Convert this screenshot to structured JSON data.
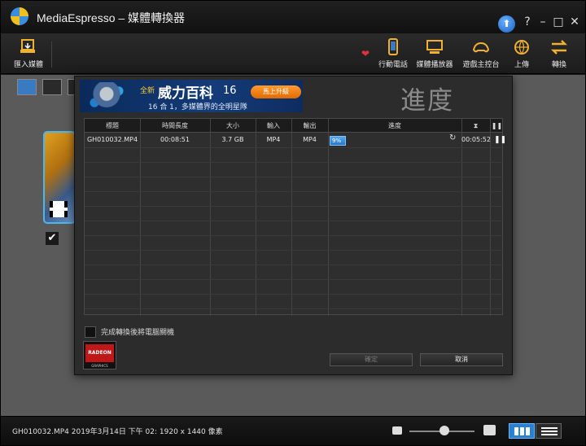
{
  "app": {
    "title": "MediaEspresso – 媒體轉換器"
  },
  "window_controls": {
    "help": "?",
    "minimize": "–",
    "maximize": "□",
    "close": "✕"
  },
  "toolbar": {
    "import_label": "匯入媒體",
    "items": [
      {
        "label": "行動電話",
        "icon": "phone-icon"
      },
      {
        "label": "媒體播放器",
        "icon": "media-player-icon"
      },
      {
        "label": "遊戲主控台",
        "icon": "game-console-icon"
      },
      {
        "label": "上傳",
        "icon": "upload-globe-icon"
      },
      {
        "label": "轉換",
        "icon": "convert-icon"
      }
    ]
  },
  "banner": {
    "new_label": "全新",
    "title": "威力百科",
    "number": "16",
    "subtitle": "16 合 1，多媒體界的全明星隊",
    "button": "馬上升級"
  },
  "dialog": {
    "title": "進度",
    "columns": [
      "標題",
      "時間長度",
      "大小",
      "輸入",
      "輸出",
      "進度",
      "⧗",
      "❚❚"
    ],
    "rows": [
      {
        "title": "GH010032.MP4",
        "duration": "00:08:51",
        "size": "3.7 GB",
        "input": "MP4",
        "output": "MP4",
        "progress_text": "9%",
        "progress": 0.09,
        "remaining": "00:05:52"
      }
    ],
    "shutdown_label": "完成轉換後將電腦關機",
    "ok_button": "確定",
    "cancel_button": "取消",
    "radeon_label": "RADEON",
    "radeon_sub": "GRAPHICS"
  },
  "statusbar": {
    "text": "GH010032.MP4  2019年3月14日 下午 02:  1920 x 1440 像素"
  },
  "colors": {
    "accent": "#2a80d0",
    "progress": "#50a8f0",
    "radeon_red": "#c01818"
  }
}
